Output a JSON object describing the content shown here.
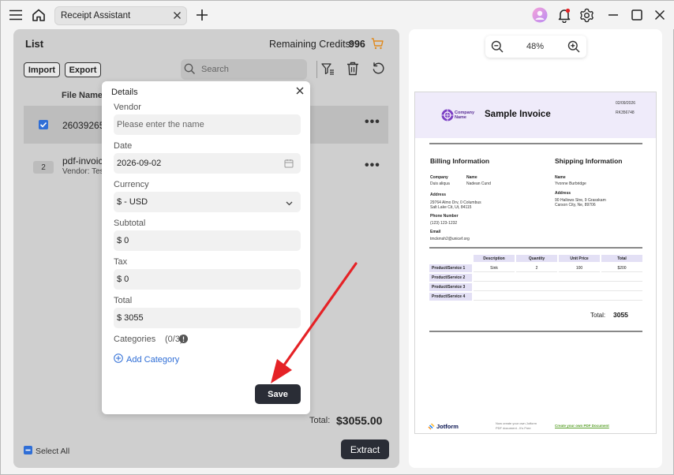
{
  "window": {
    "tab_title": "Receipt Assistant"
  },
  "list": {
    "title": "List",
    "credits_label": "Remaining Credits:",
    "credits_value": "996",
    "import_label": "Import",
    "export_label": "Export",
    "search_placeholder": "Search",
    "column_file_name": "File Name",
    "rows": [
      {
        "file": "260392651",
        "vendor": ""
      },
      {
        "index": "2",
        "file": "pdf-invoic",
        "vendor": "Vendor: Tes"
      }
    ],
    "total_label": "Total:",
    "total_value": "$3055.00",
    "select_all_label": "Select All",
    "extract_label": "Extract"
  },
  "details": {
    "title": "Details",
    "vendor_label": "Vendor",
    "vendor_placeholder": "Please enter the name",
    "date_label": "Date",
    "date_value": "2026-09-02",
    "currency_label": "Currency",
    "currency_value": "$ - USD",
    "subtotal_label": "Subtotal",
    "subtotal_value": "$ 0",
    "tax_label": "Tax",
    "tax_value": "$ 0",
    "total_label": "Total",
    "total_value": "$ 3055",
    "categories_label": "Categories",
    "categories_count": "(0/3)",
    "add_category_label": "Add Category",
    "save_label": "Save"
  },
  "preview": {
    "zoom": "48%"
  },
  "invoice": {
    "company_name": "Company Name",
    "title": "Sample Invoice",
    "date": "02/09/2026",
    "number": "RK356748",
    "billing_heading": "Billing Information",
    "shipping_heading": "Shipping Information",
    "billing": {
      "company_label": "Company",
      "company_value": "Duis aliqua",
      "name_label": "Name",
      "name_value": "Nadean Cund",
      "address_label": "Address",
      "address_line1": "29764 Almo Drv, 0 Columbus",
      "address_line2": "Salt Lake Cit, Ut, 84115",
      "phone_label": "Phone Number",
      "phone_value": "(123) 123-1232",
      "email_label": "Email",
      "email_value": "tmckmsh2@unicef.org"
    },
    "shipping": {
      "name_label": "Name",
      "name_value": "Yvonne Burbridge",
      "address_label": "Address",
      "address_line1": "90 Hallows Stre, 9 Grasskam",
      "address_line2": "Carson City, Ne, 89706"
    },
    "table_headers": [
      "Description",
      "Quantity",
      "Unit Price",
      "Total"
    ],
    "table_rows": [
      {
        "product": "Product/Service 1",
        "description": "Sink",
        "quantity": "2",
        "unit_price": "100",
        "total": "$200"
      },
      {
        "product": "Product/Service 2",
        "description": "",
        "quantity": "",
        "unit_price": "",
        "total": ""
      },
      {
        "product": "Product/Service 3",
        "description": "",
        "quantity": "",
        "unit_price": "",
        "total": ""
      },
      {
        "product": "Product/Service 4",
        "description": "",
        "quantity": "",
        "unit_price": "",
        "total": ""
      }
    ],
    "total_label": "Total:",
    "total_value": "3055",
    "footer_brand": "Jotform",
    "footer_note_line1": "Now create your own Jotform",
    "footer_note_line2": "PDF document - It's Free",
    "footer_link": "Create your own PDF Document"
  },
  "colors": {
    "dark_button": "#2a2d36",
    "accent_blue": "#2f6ed6",
    "cart_orange": "#e08a1e",
    "annotation_red": "#e52226",
    "invoice_header": "#efebfa"
  }
}
